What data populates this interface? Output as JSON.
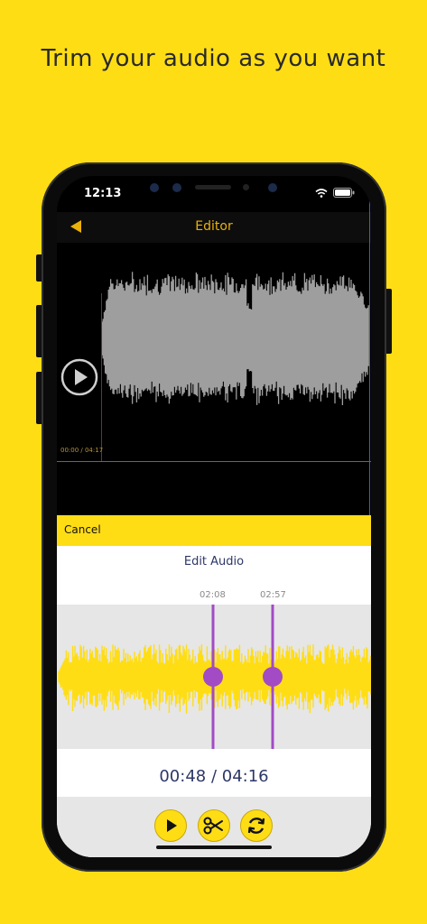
{
  "headline": "Trim your audio as you want",
  "status": {
    "time": "12:13"
  },
  "nav": {
    "title": "Editor"
  },
  "top_player": {
    "time_readout": "00:00 / 04:17"
  },
  "cancel_label": "Cancel",
  "edit": {
    "title": "Edit Audio",
    "start_marker": "02:08",
    "end_marker": "02:57",
    "time_readout": "00:48 / 04:16"
  },
  "colors": {
    "background": "#FFDD15",
    "accent_gold": "#E9B10A",
    "waveform_gray": "#9E9E9E",
    "waveform_yellow": "#FFDD15",
    "marker_purple": "#A24BC5",
    "text_navy": "#2D3768"
  },
  "controls": [
    {
      "name": "play-icon"
    },
    {
      "name": "scissors-icon"
    },
    {
      "name": "refresh-icon"
    }
  ]
}
